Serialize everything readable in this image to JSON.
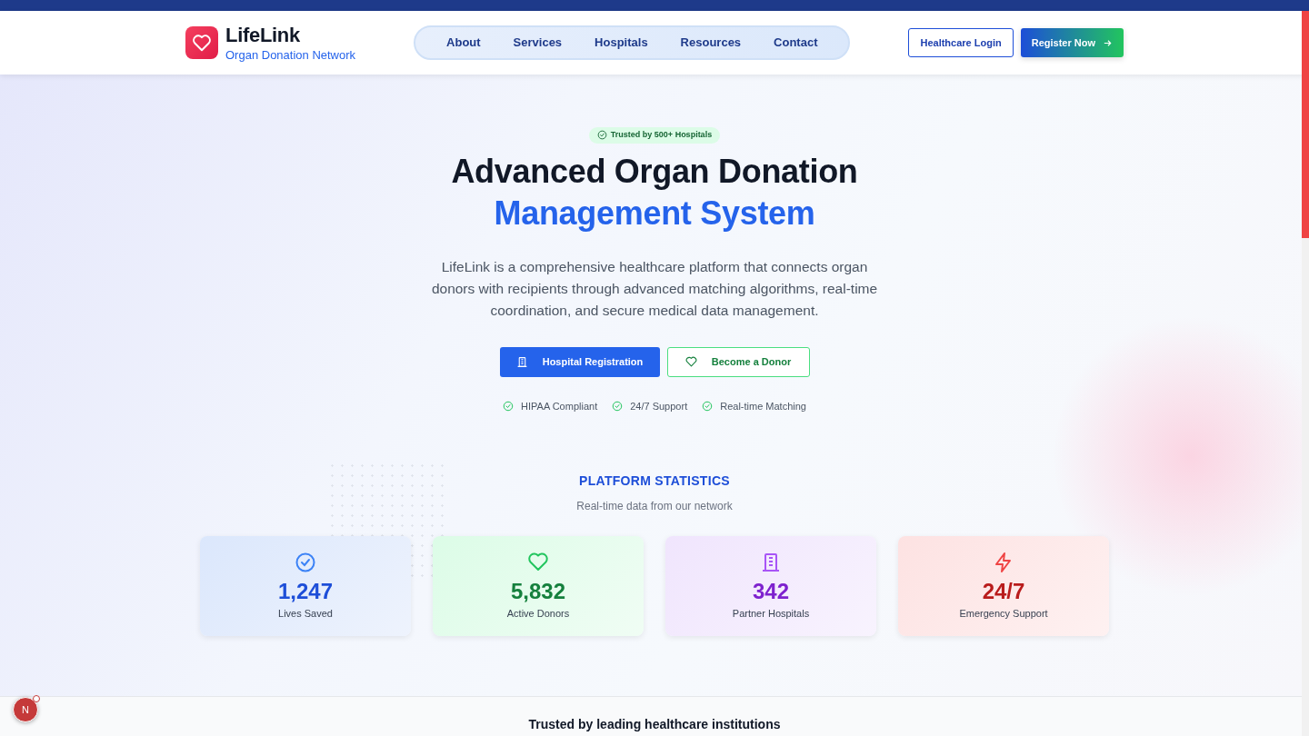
{
  "brand": {
    "name": "LifeLink",
    "tagline": "Organ Donation Network"
  },
  "nav": [
    {
      "label": "About"
    },
    {
      "label": "Services"
    },
    {
      "label": "Hospitals"
    },
    {
      "label": "Resources"
    },
    {
      "label": "Contact"
    }
  ],
  "header_buttons": {
    "login": "Healthcare Login",
    "register": "Register Now"
  },
  "hero": {
    "badge": "Trusted by 500+ Hospitals",
    "title_line1": "Advanced Organ Donation",
    "title_line2": "Management System",
    "description": "LifeLink is a comprehensive healthcare platform that connects organ donors with recipients through advanced matching algorithms, real-time coordination, and secure medical data management.",
    "primary_button": "Hospital Registration",
    "secondary_button": "Become a Donor",
    "features": [
      "HIPAA Compliant",
      "24/7 Support",
      "Real-time Matching"
    ]
  },
  "stats_section": {
    "heading": "PLATFORM STATISTICS",
    "subheading": "Real-time data from our network",
    "stats": [
      {
        "kind": "check",
        "value": "1,247",
        "label": "Lives Saved",
        "color": "#1d4ed8"
      },
      {
        "kind": "heart",
        "value": "5,832",
        "label": "Active Donors",
        "color": "#15803d"
      },
      {
        "kind": "building",
        "value": "342",
        "label": "Partner Hospitals",
        "color": "#7e22ce"
      },
      {
        "kind": "bolt",
        "value": "24/7",
        "label": "Emergency Support",
        "color": "#b91c1c"
      }
    ]
  },
  "next_section": {
    "title": "Trusted by leading healthcare institutions"
  },
  "dev_badge": "N"
}
